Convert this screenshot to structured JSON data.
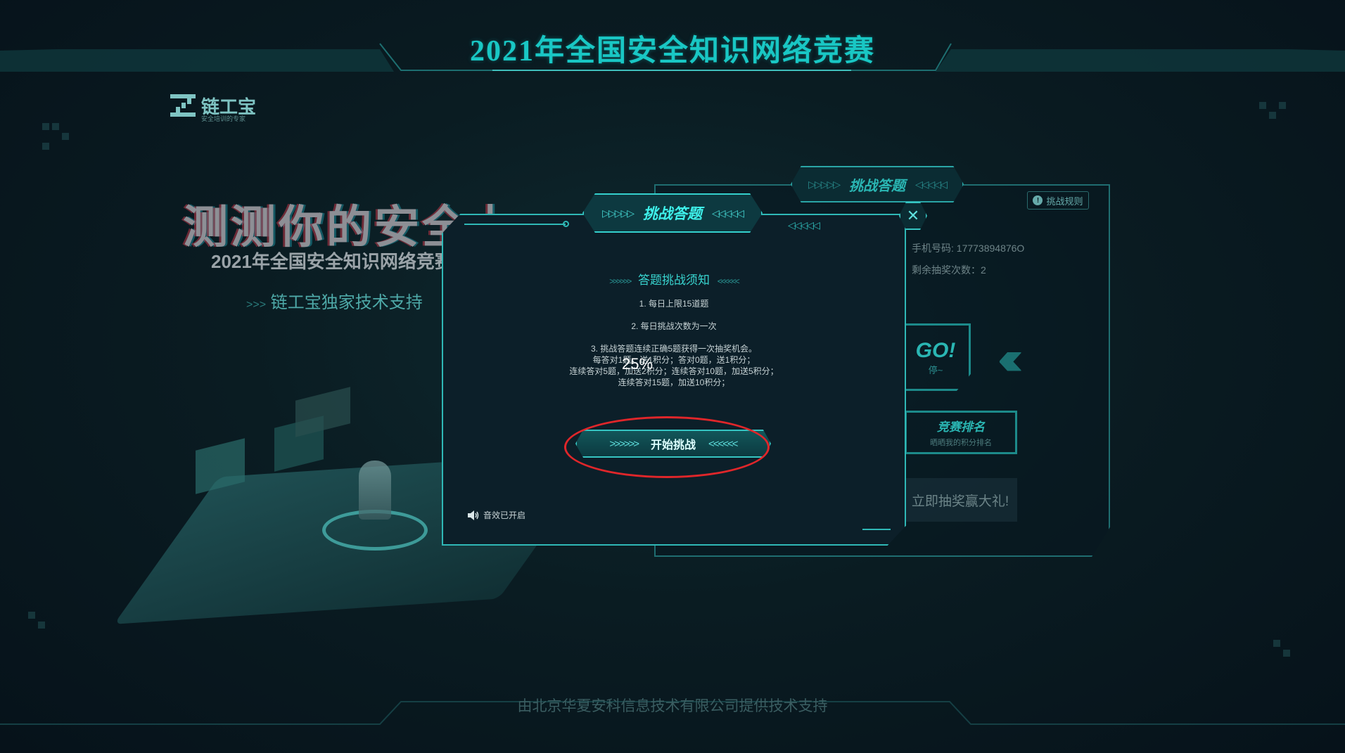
{
  "header": {
    "title": "2021年全国安全知识网络竞赛"
  },
  "logo": {
    "name": "链工宝",
    "tagline": "安全培训的专家"
  },
  "hero": {
    "title": "测测你的安全力",
    "subtitle": "2021年全国安全知识网络竞赛",
    "support": "链工宝独家技术支持"
  },
  "background_panel": {
    "tab_label": "挑战答题",
    "rules_button": "挑战规则",
    "phone": "手机号码: 17773894876O",
    "remaining_draws": "剩余抽奖次数：2",
    "go_label": "GO!",
    "go_sub": "停~",
    "ranking_title": "竞赛排名",
    "ranking_sub": "晒晒我的积分排名",
    "lottery": "立即抽奖赢大礼!"
  },
  "modal": {
    "tab_label": "挑战答题",
    "notice_title": "答题挑战须知",
    "rules": [
      "1. 每日上限15道题",
      "2. 每日挑战次数为一次",
      "3. 挑战答题连续正确5题获得一次抽奖机会。"
    ],
    "scoring": [
      "每答对1题，送1积分；答对0题，送1积分；",
      "连续答对5题，加送2积分；连续答对10题，加送5积分；",
      "连续答对15题，加送10积分；"
    ],
    "progress": "25%",
    "start_button": "开始挑战",
    "sound_label": "音效已开启"
  },
  "footer": {
    "text": "由北京华夏安科信息技术有限公司提供技术支持"
  },
  "chevrons": {
    "right": "▷▷▷▷▷",
    "left": "◁◁◁◁◁",
    "right_s": ">>>>>>",
    "left_s": "<<<<<<"
  },
  "colors": {
    "accent": "#2fb8b6",
    "highlight": "#e0262a",
    "background": "#0a1c22"
  }
}
